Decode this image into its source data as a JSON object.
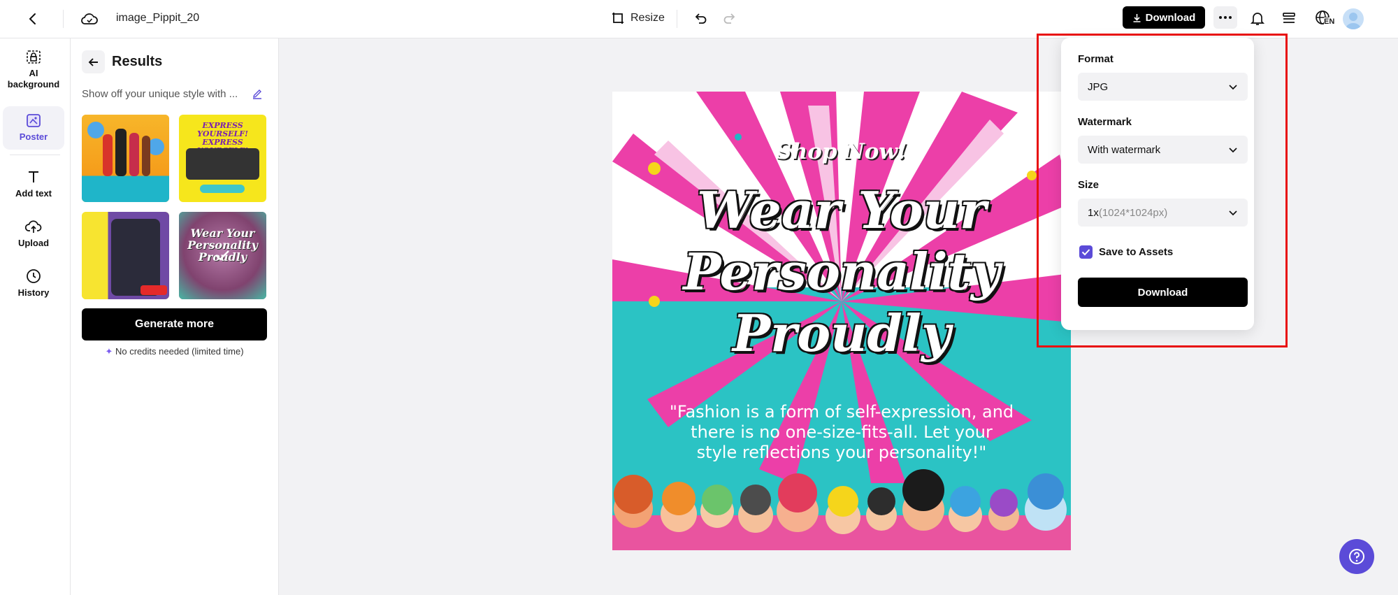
{
  "topbar": {
    "filename": "image_Pippit_20",
    "resize_label": "Resize",
    "download_label": "Download",
    "language_badge": "EN"
  },
  "nav": {
    "items": [
      {
        "label": "AI background",
        "icon": "ai-background-icon"
      },
      {
        "label": "Poster",
        "icon": "poster-icon"
      },
      {
        "label": "Add text",
        "icon": "text-icon"
      },
      {
        "label": "Upload",
        "icon": "upload-icon"
      },
      {
        "label": "History",
        "icon": "history-icon"
      }
    ],
    "active": "Poster"
  },
  "panel": {
    "title": "Results",
    "prompt": "Show off your unique style with ...",
    "generate_label": "Generate more",
    "credits_note": "No credits needed (limited time)",
    "thumbnails": [
      {
        "text": ""
      },
      {
        "text": "EXPRESS YOURSELF! EXPRESS YOURSELF!"
      },
      {
        "text": ""
      },
      {
        "text": "Wear Your Personality Proudly"
      }
    ]
  },
  "poster": {
    "tagline": "Shop Now!",
    "headline_line1": "Wear Your",
    "headline_line2": "Personality",
    "headline_line3": "Proudly",
    "quote": "\"Fashion is a form of self-expression, and there is no one-size-fits-all. Let your style reflections your personality!\""
  },
  "download_popup": {
    "format_label": "Format",
    "format_value": "JPG",
    "watermark_label": "Watermark",
    "watermark_value": "With watermark",
    "size_label": "Size",
    "size_value_main": "1x",
    "size_value_dim": "(1024*1024px)",
    "save_to_assets_label": "Save to Assets",
    "save_to_assets_checked": true,
    "download_label": "Download"
  },
  "colors": {
    "accent": "#5b4bd8",
    "highlight_border": "#e81010",
    "primary_button": "#000000"
  }
}
